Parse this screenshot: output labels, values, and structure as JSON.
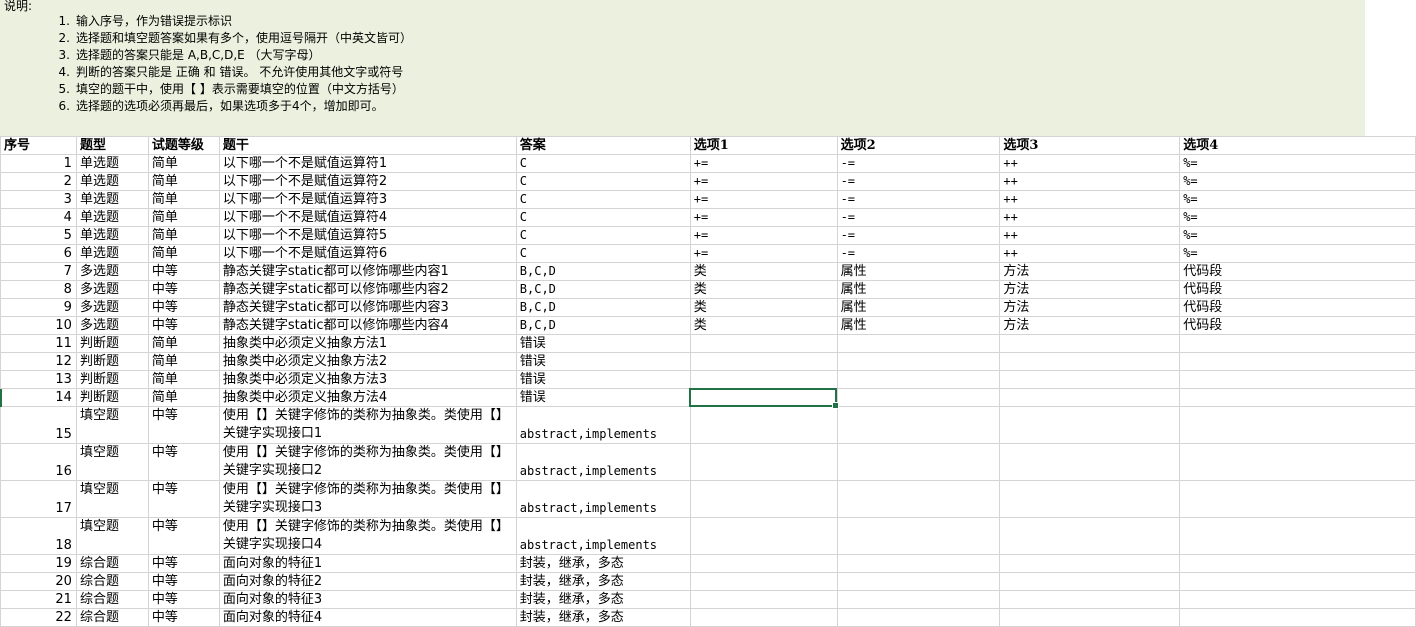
{
  "notes": {
    "title": "说明:",
    "items": [
      {
        "n": "1.",
        "text": "输入序号，作为错误提示标识"
      },
      {
        "n": "2.",
        "text": "选择题和填空题答案如果有多个，使用逗号隔开（中英文皆可）"
      },
      {
        "n": "3.",
        "text": "选择题的答案只能是 A,B,C,D,E  （大写字母）"
      },
      {
        "n": "4.",
        "text": "判断的答案只能是 正确  和 错误。 不允许使用其他文字或符号"
      },
      {
        "n": "5.",
        "text": "填空的题干中，使用【 】表示需要填空的位置（中文方括号）"
      },
      {
        "n": "6.",
        "text": "选择题的选项必须再最后，如果选项多于4个，增加即可。"
      }
    ]
  },
  "sheet": {
    "headers": [
      "序号",
      "题型",
      "试题等级",
      "题干",
      "答案",
      "选项1",
      "选项2",
      "选项3",
      "选项4"
    ],
    "rows": [
      [
        "1",
        "单选题",
        "简单",
        "以下哪一个不是赋值运算符1",
        "C",
        "+=",
        "-=",
        "++",
        "%="
      ],
      [
        "2",
        "单选题",
        "简单",
        "以下哪一个不是赋值运算符2",
        "C",
        "+=",
        "-=",
        "++",
        "%="
      ],
      [
        "3",
        "单选题",
        "简单",
        "以下哪一个不是赋值运算符3",
        "C",
        "+=",
        "-=",
        "++",
        "%="
      ],
      [
        "4",
        "单选题",
        "简单",
        "以下哪一个不是赋值运算符4",
        "C",
        "+=",
        "-=",
        "++",
        "%="
      ],
      [
        "5",
        "单选题",
        "简单",
        "以下哪一个不是赋值运算符5",
        "C",
        "+=",
        "-=",
        "++",
        "%="
      ],
      [
        "6",
        "单选题",
        "简单",
        "以下哪一个不是赋值运算符6",
        "C",
        "+=",
        "-=",
        "++",
        "%="
      ],
      [
        "7",
        "多选题",
        "中等",
        "静态关键字static都可以修饰哪些内容1",
        "B,C,D",
        "类",
        "属性",
        "方法",
        "代码段"
      ],
      [
        "8",
        "多选题",
        "中等",
        "静态关键字static都可以修饰哪些内容2",
        "B,C,D",
        "类",
        "属性",
        "方法",
        "代码段"
      ],
      [
        "9",
        "多选题",
        "中等",
        "静态关键字static都可以修饰哪些内容3",
        "B,C,D",
        "类",
        "属性",
        "方法",
        "代码段"
      ],
      [
        "10",
        "多选题",
        "中等",
        "静态关键字static都可以修饰哪些内容4",
        "B,C,D",
        "类",
        "属性",
        "方法",
        "代码段"
      ],
      [
        "11",
        "判断题",
        "简单",
        "抽象类中必须定义抽象方法1",
        "错误",
        "",
        "",
        "",
        ""
      ],
      [
        "12",
        "判断题",
        "简单",
        "抽象类中必须定义抽象方法2",
        "错误",
        "",
        "",
        "",
        ""
      ],
      [
        "13",
        "判断题",
        "简单",
        "抽象类中必须定义抽象方法3",
        "错误",
        "",
        "",
        "",
        ""
      ],
      [
        "14",
        "判断题",
        "简单",
        "抽象类中必须定义抽象方法4",
        "错误",
        "",
        "",
        "",
        ""
      ],
      [
        "15",
        "填空题",
        "中等",
        "使用【】关键字修饰的类称为抽象类。类使用【】关键字实现接口1",
        "abstract,implements",
        "",
        "",
        "",
        ""
      ],
      [
        "16",
        "填空题",
        "中等",
        "使用【】关键字修饰的类称为抽象类。类使用【】关键字实现接口2",
        "abstract,implements",
        "",
        "",
        "",
        ""
      ],
      [
        "17",
        "填空题",
        "中等",
        "使用【】关键字修饰的类称为抽象类。类使用【】关键字实现接口3",
        "abstract,implements",
        "",
        "",
        "",
        ""
      ],
      [
        "18",
        "填空题",
        "中等",
        "使用【】关键字修饰的类称为抽象类。类使用【】关键字实现接口4",
        "abstract,implements",
        "",
        "",
        "",
        ""
      ],
      [
        "19",
        "综合题",
        "中等",
        "面向对象的特征1",
        "封装，继承，多态",
        "",
        "",
        "",
        ""
      ],
      [
        "20",
        "综合题",
        "中等",
        "面向对象的特征2",
        "封装，继承，多态",
        "",
        "",
        "",
        ""
      ],
      [
        "21",
        "综合题",
        "中等",
        "面向对象的特征3",
        "封装，继承，多态",
        "",
        "",
        "",
        ""
      ],
      [
        "22",
        "综合题",
        "中等",
        "面向对象的特征4",
        "封装，继承，多态",
        "",
        "",
        "",
        ""
      ]
    ]
  },
  "selection": {
    "row": "14",
    "column": "选项1"
  },
  "colors": {
    "notes_bg": "#ebf1de",
    "grid": "#d4d4d4",
    "selection": "#217346"
  }
}
